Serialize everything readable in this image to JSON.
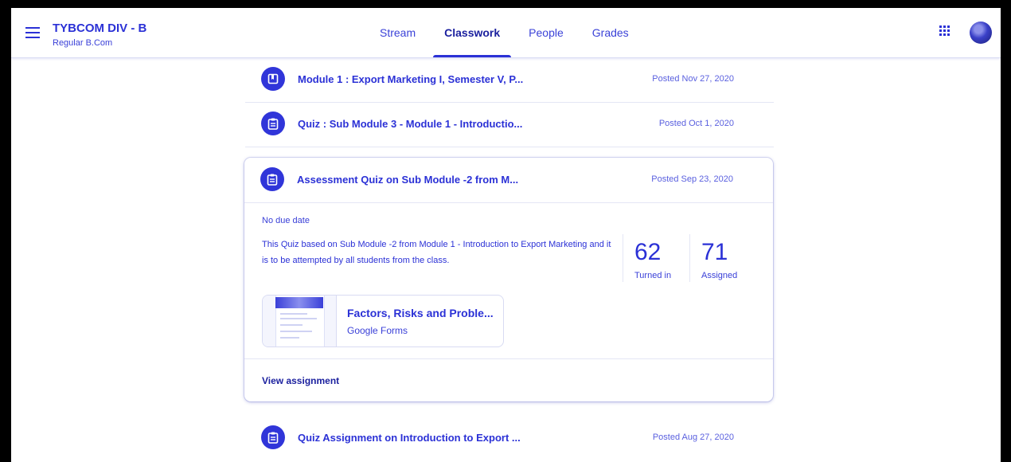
{
  "header": {
    "class_name": "TYBCOM DIV - B",
    "section": "Regular B.Com",
    "tabs": [
      {
        "label": "Stream"
      },
      {
        "label": "Classwork"
      },
      {
        "label": "People"
      },
      {
        "label": "Grades"
      }
    ],
    "active_tab": "Classwork"
  },
  "items": [
    {
      "title": "Module 1 : Export Marketing I, Semester V, P...",
      "date": "Posted Nov 27, 2020",
      "icon": "material-icon"
    },
    {
      "title": "Quiz : Sub Module 3 - Module 1 - Introductio...",
      "date": "Posted Oct 1, 2020",
      "icon": "assignment-icon"
    }
  ],
  "expanded": {
    "title": "Assessment Quiz on Sub Module -2 from M...",
    "date": "Posted Sep 23, 2020",
    "icon": "assignment-icon",
    "due": "No due date",
    "description": "This Quiz based on Sub Module -2 from Module 1 - Introduction to Export Marketing and it is to be attempted by all students from the class.",
    "turned_in": {
      "value": "62",
      "label": "Turned in"
    },
    "assigned": {
      "value": "71",
      "label": "Assigned"
    },
    "attachment": {
      "title": "Factors, Risks and Proble...",
      "type": "Google Forms"
    },
    "view_link": "View assignment"
  },
  "last_item": {
    "title": "Quiz Assignment on Introduction to Export ...",
    "date": "Posted Aug 27, 2020",
    "icon": "assignment-icon"
  },
  "colors": {
    "accent": "#2b31d6",
    "accent_dark": "#1a1f9e",
    "border": "#e4e6f5"
  }
}
